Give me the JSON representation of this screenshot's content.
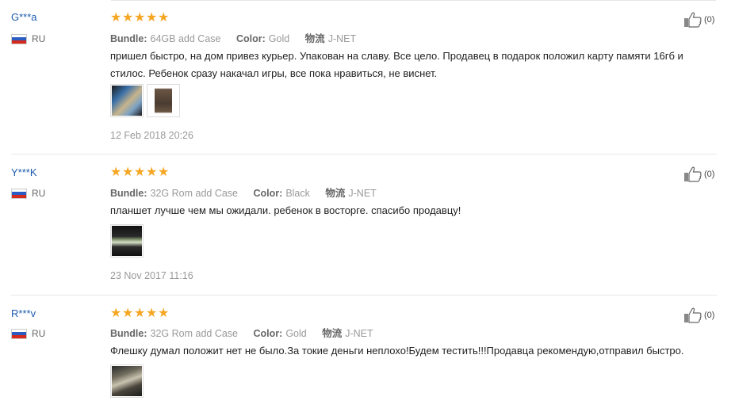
{
  "labels": {
    "bundle": "Bundle:",
    "color": "Color:",
    "shipping": "物流"
  },
  "reviews": [
    {
      "user": "G***a",
      "country": "RU",
      "rating": 5,
      "bundle": "64GB add Case",
      "color": "Gold",
      "shipping": "J-NET",
      "text": "пришел быстро, на дом привез курьер. Упакован на славу. Все цело. Продавец в подарок положил карту памяти 16гб и стилос. Ребенок сразу накачал игры, все пока нравиться, не виснет.",
      "photos": 2,
      "date": "12 Feb 2018 20:26",
      "likes": "(0)"
    },
    {
      "user": "Y***K",
      "country": "RU",
      "rating": 5,
      "bundle": "32G Rom add Case",
      "color": "Black",
      "shipping": "J-NET",
      "text": "планшет лучше чем мы ожидали. ребенок в восторге. спасибо продавцу!",
      "photos": 1,
      "date": "23 Nov 2017 11:16",
      "likes": "(0)"
    },
    {
      "user": "R***v",
      "country": "RU",
      "rating": 5,
      "bundle": "32G Rom add Case",
      "color": "Gold",
      "shipping": "J-NET",
      "text": "Флешку думал положит нет не было.За токие деньги неплохо!Будем тестить!!!Продавца рекомендую,отправил быстро.",
      "photos": 1,
      "date": "",
      "likes": "(0)"
    }
  ],
  "icons": {
    "like": "thumbs-up-icon",
    "flag": "russia-flag-icon",
    "star": "star-icon"
  },
  "colors": {
    "star": "#f5a623",
    "username": "#1c5bb0",
    "muted": "#999999"
  }
}
